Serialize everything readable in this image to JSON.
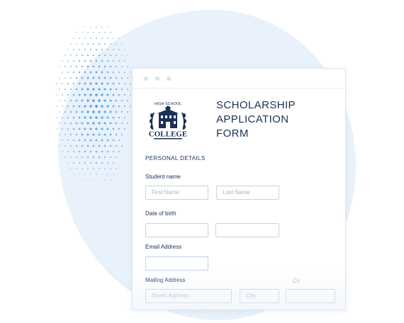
{
  "colors": {
    "accent": "#1c3057",
    "blob": "#e9f1fa",
    "dots": "#4a9ee6",
    "field_border": "#c6d3e2",
    "placeholder": "#a7b4c5"
  },
  "logo": {
    "top_text": "HIGH SCHOOL",
    "main_text": "COLLEGE"
  },
  "form": {
    "title_lines": [
      "SCHOLARSHIP",
      "APPLICATION",
      "FORM"
    ],
    "section_title": "PERSONAL DETAILS",
    "student_name": {
      "label": "Student name",
      "first_placeholder": "First Name",
      "last_placeholder": "Last Name"
    },
    "dob": {
      "label": "Date of birth"
    },
    "email": {
      "label": "Email Address"
    },
    "mailing": {
      "label": "Mailing Address",
      "street_placeholder": "Street Address",
      "city_placeholder": "City",
      "cut_label": "Co"
    }
  }
}
